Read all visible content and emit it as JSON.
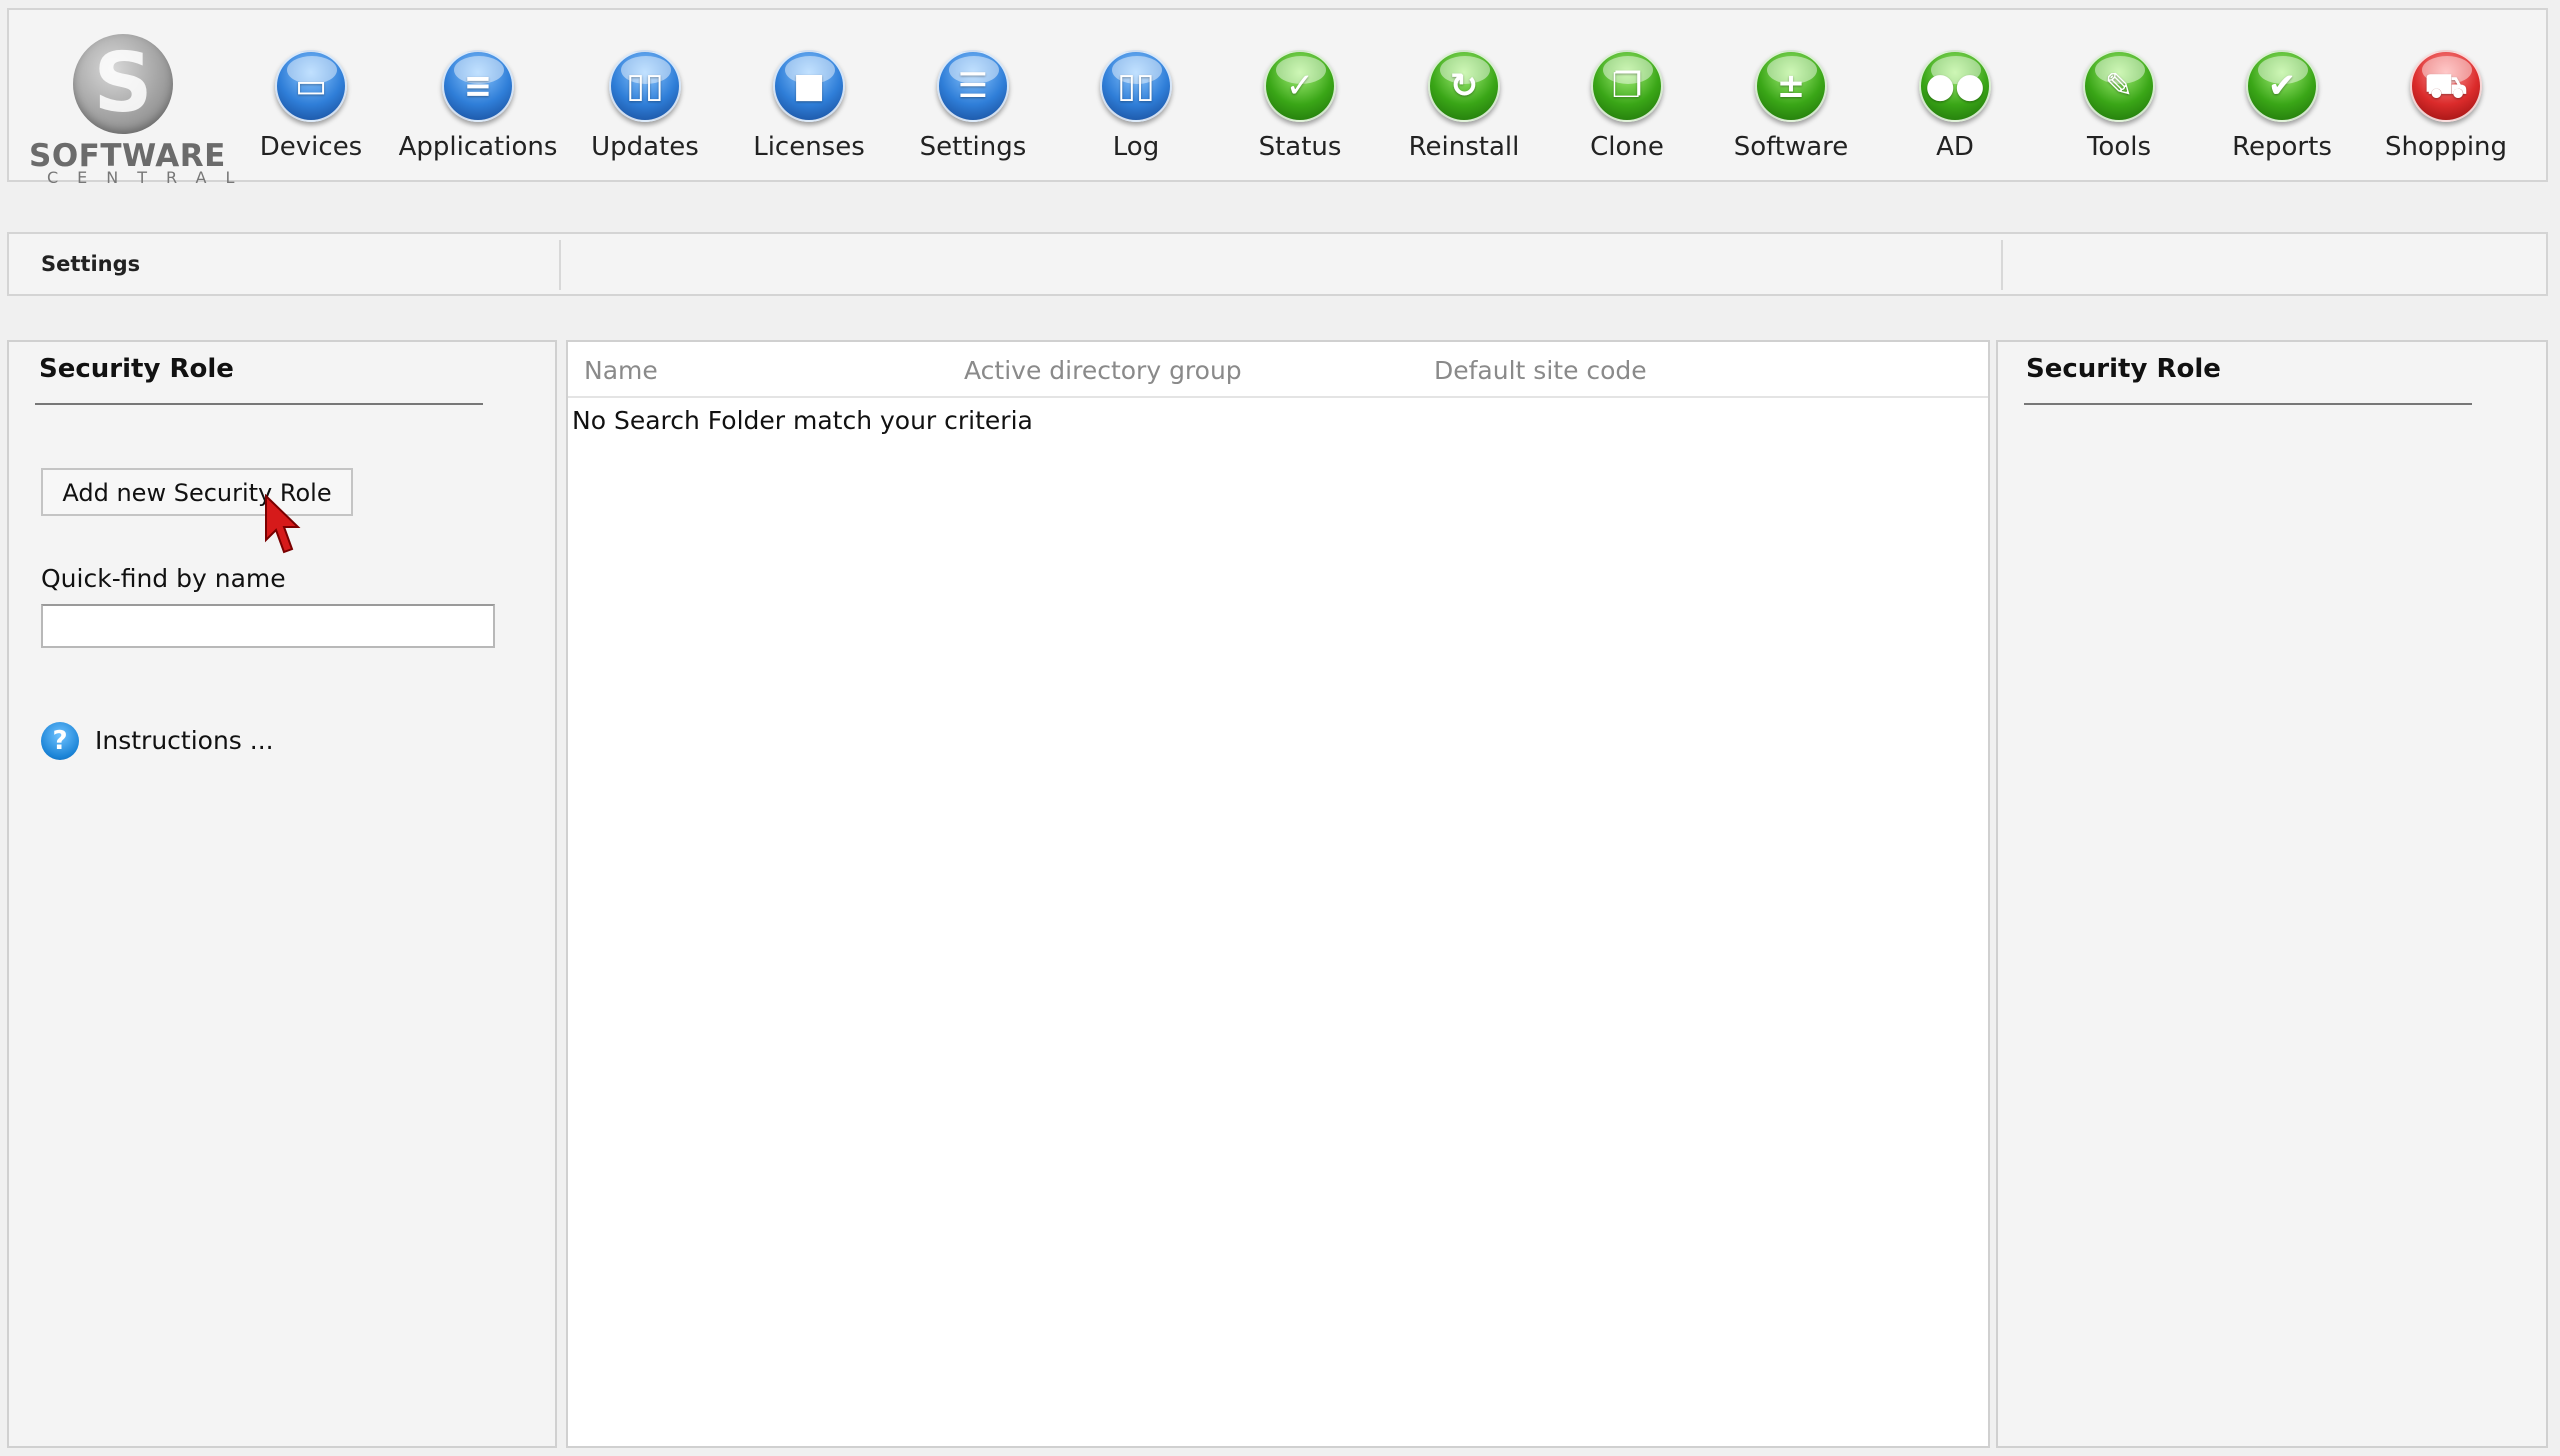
{
  "app": {
    "logo_line1": "SOFTWARE",
    "logo_line2": "CENTRAL"
  },
  "nav": [
    {
      "label": "Devices",
      "icon": "monitor-icon",
      "color": "#2f7ed8"
    },
    {
      "label": "Applications",
      "icon": "stack-icon",
      "color": "#2f7ed8"
    },
    {
      "label": "Updates",
      "icon": "book-open-icon",
      "color": "#2f7ed8"
    },
    {
      "label": "Licenses",
      "icon": "folder-icon",
      "color": "#2f7ed8"
    },
    {
      "label": "Settings",
      "icon": "checklist-icon",
      "color": "#2f7ed8"
    },
    {
      "label": "Log",
      "icon": "book-icon",
      "color": "#2f7ed8"
    },
    {
      "label": "Status",
      "icon": "checkmark-icon",
      "color": "#3aa617"
    },
    {
      "label": "Reinstall",
      "icon": "refresh-icon",
      "color": "#3aa617"
    },
    {
      "label": "Clone",
      "icon": "copy-icon",
      "color": "#3aa617"
    },
    {
      "label": "Software",
      "icon": "plus-minus-icon",
      "color": "#3aa617"
    },
    {
      "label": "AD",
      "icon": "users-icon",
      "color": "#3aa617"
    },
    {
      "label": "Tools",
      "icon": "wrench-icon",
      "color": "#3aa617"
    },
    {
      "label": "Reports",
      "icon": "clipboard-icon",
      "color": "#3aa617"
    },
    {
      "label": "Shopping",
      "icon": "cart-icon",
      "color": "#db2b2b"
    }
  ],
  "breadcrumb": {
    "title": "Settings"
  },
  "left_panel": {
    "heading": "Security Role",
    "add_button": "Add new Security Role",
    "quickfind_label": "Quick-find by name",
    "quickfind_value": "",
    "instructions": "Instructions ..."
  },
  "table": {
    "columns": [
      "Name",
      "Active directory group",
      "Default site code"
    ],
    "empty_message": "No Search Folder match your criteria"
  },
  "right_panel": {
    "heading": "Security Role"
  }
}
